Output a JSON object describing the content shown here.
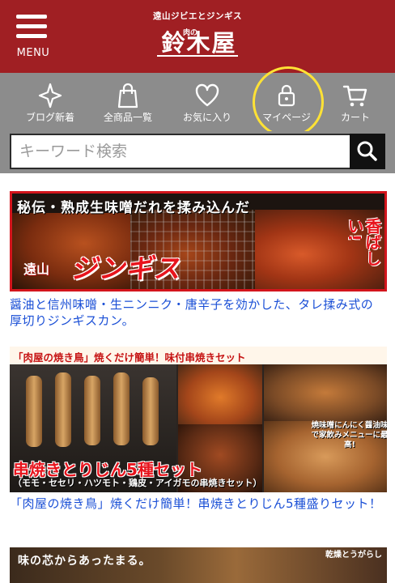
{
  "header": {
    "menu_label": "MENU",
    "logo_top": "遠山ジビエとジンギス",
    "logo_small": "肉の",
    "logo_main": "鈴木屋"
  },
  "nav": {
    "items": [
      {
        "label": "ブログ新着",
        "icon": "sparkle-icon"
      },
      {
        "label": "全商品一覧",
        "icon": "shopping-bag-icon"
      },
      {
        "label": "お気に入り",
        "icon": "heart-icon"
      },
      {
        "label": "マイページ",
        "icon": "lock-icon"
      },
      {
        "label": "カート",
        "icon": "cart-icon"
      }
    ]
  },
  "search": {
    "placeholder": "キーワード検索",
    "value": ""
  },
  "banners": [
    {
      "headline": "秘伝・熟成生味噌だれを揉み込んだ",
      "brand_small": "遠山",
      "brand_big": "ジンギス",
      "accent": "香ばしい!",
      "caption": "醤油と信州味噌・生ニンニク・唐辛子を効かした、タレ揉み式の厚切りジンギスカン。"
    },
    {
      "headline": "「肉屋の焼き鳥」焼くだけ簡単！味付串焼きセット",
      "note": "焼味噌にんにく醤油味で家飲みメニューに最高!",
      "title": "串焼きとりじん5種セット",
      "subtitle": "（モモ・セセリ・ハツモト・鶏皮・アイガモの串焼きセット）",
      "caption": "「肉屋の焼き鳥」焼くだけ簡単！串焼きとりじん5種盛りセット！"
    },
    {
      "headline": "味の芯からあったまる。",
      "side": "乾燥とうがらし"
    }
  ],
  "colors": {
    "header_bg": "#a01f23",
    "nav_bg": "#8c8c8c",
    "link": "#1a4fd6",
    "highlight_ring": "#ffe235"
  }
}
